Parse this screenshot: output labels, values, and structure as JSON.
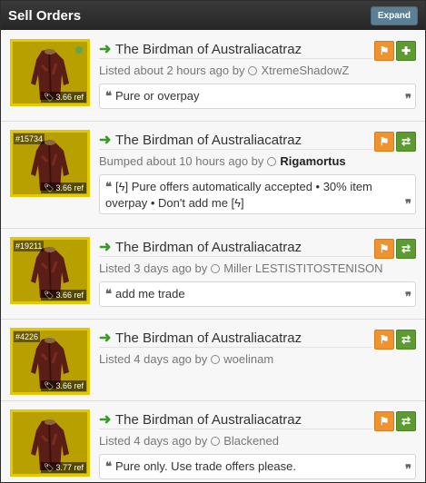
{
  "header": {
    "title": "Sell Orders",
    "expand_label": "Expand"
  },
  "colors": {
    "arrow": "#3c9a2c",
    "flag_button": "#f0922e",
    "trade_button": "#5d9a2f",
    "item_bg": "#b8a000"
  },
  "orders": [
    {
      "item_name": "The Birdman of Australiacatraz",
      "id_badge": "",
      "price": "3.66 ref",
      "meta_prefix": "Listed about 2 hours ago by",
      "user": "XtremeShadowZ",
      "comment": "Pure or overpay",
      "second_action_icon": "plus-icon"
    },
    {
      "item_name": "The Birdman of Australiacatraz",
      "id_badge": "#15734",
      "price": "3.66 ref",
      "meta_prefix": "Bumped about 10 hours ago by",
      "user": "Rigamortus",
      "comment": "[ϟ] Pure offers automatically accepted • 30% item overpay • Don't add me [ϟ]",
      "second_action_icon": "trade-icon"
    },
    {
      "item_name": "The Birdman of Australiacatraz",
      "id_badge": "#19211",
      "price": "3.66 ref",
      "meta_prefix": "Listed 3 days ago by",
      "user": "Miller LESTISTITOSTENISON",
      "comment": "add me trade",
      "second_action_icon": "trade-icon"
    },
    {
      "item_name": "The Birdman of Australiacatraz",
      "id_badge": "#4226",
      "price": "3.66 ref",
      "meta_prefix": "Listed 4 days ago by",
      "user": "woelinam",
      "comment": "",
      "second_action_icon": "trade-icon"
    },
    {
      "item_name": "The Birdman of Australiacatraz",
      "id_badge": "",
      "price": "3.77 ref",
      "meta_prefix": "Listed 4 days ago by",
      "user": "Blackened",
      "comment": "Pure only. Use trade offers please.",
      "second_action_icon": "trade-icon"
    }
  ]
}
